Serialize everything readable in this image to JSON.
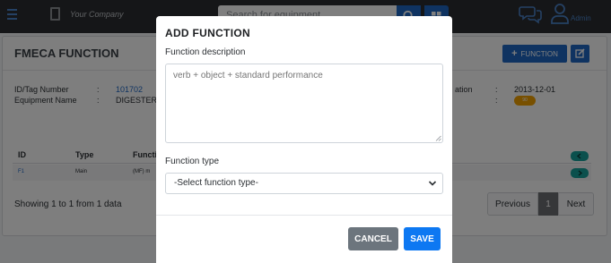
{
  "navbar": {
    "company_name": "Your Company",
    "search_placeholder": "Search for equipment",
    "user_label": "Admin",
    "icons": [
      "menu-icon",
      "building-icon",
      "search-icon",
      "grid-icon",
      "chat-icon",
      "user-icon"
    ]
  },
  "page": {
    "title": "FMECA FUNCTION",
    "add_function_label": "FUNCTION",
    "info": {
      "id_label": "ID/Tag Number",
      "id_sep": ":",
      "id_value": "101702",
      "name_label": "Equipment Name",
      "name_sep": ":",
      "name_value": "DIGESTER N",
      "right_label": "ation",
      "right_sep": ":",
      "right_value": "2013-12-01",
      "status_value": "90"
    },
    "table": {
      "columns": [
        "ID",
        "Type",
        "Functi"
      ],
      "rows": [
        {
          "id": "F1",
          "type": "Main",
          "function": "(MF) m"
        }
      ]
    },
    "footer": {
      "showing": "Showing 1 to 1 from 1 data",
      "previous": "Previous",
      "current_page": "1",
      "next": "Next"
    }
  },
  "modal": {
    "title": "ADD FUNCTION",
    "description_label": "Function description",
    "description_placeholder": "verb + object + standard performance",
    "type_label": "Function type",
    "type_selected": "-Select function type-",
    "cancel_label": "CANCEL",
    "save_label": "SAVE"
  },
  "colors": {
    "navbar": "#2a2d31",
    "primary": "#1e67c3",
    "save": "#0d78f2",
    "cancel": "#6c757d",
    "teal": "#17a09a",
    "status": "#f0a000"
  }
}
